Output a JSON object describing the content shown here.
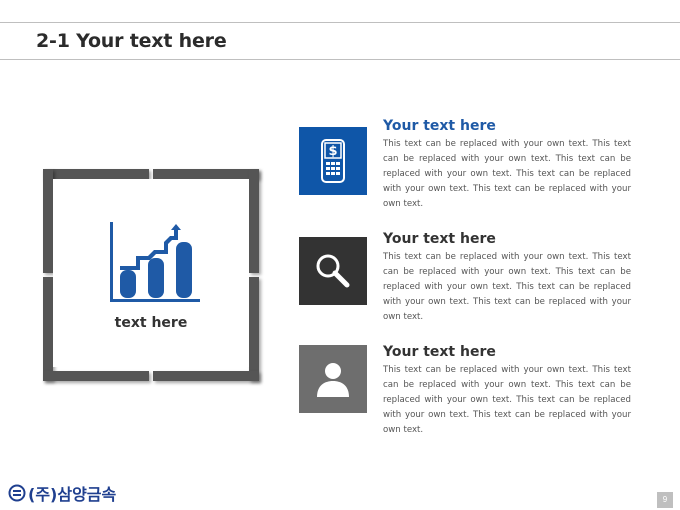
{
  "header": {
    "title": "2-1 Your text here"
  },
  "panel": {
    "label": "text here"
  },
  "items": [
    {
      "heading": "Your text here",
      "heading_color": "#1f5aa6",
      "tile_color": "#0f56a8",
      "icon": "phone-dollar-icon",
      "body": "This text can be replaced with your own text. This text can be replaced with your own text. This text can be replaced with your own text. This text can be replaced with your own text. This text can be replaced with your own text."
    },
    {
      "heading": "Your text here",
      "heading_color": "#333333",
      "tile_color": "#333333",
      "icon": "search-icon",
      "body": "This text can be replaced with your own text. This text can be replaced with your own text. This text can be replaced with your own text. This text can be replaced with your own text. This text can be replaced with your own text."
    },
    {
      "heading": "Your text here",
      "heading_color": "#333333",
      "tile_color": "#6e6e6e",
      "icon": "user-icon",
      "body": "This text can be replaced with your own text. This text can be replaced with your own text. This text can be replaced with your own text. This text can be replaced with your own text. This text can be replaced with your own text."
    }
  ],
  "footer": {
    "logo_text": "(주)삼양금속",
    "page_number": "9"
  }
}
